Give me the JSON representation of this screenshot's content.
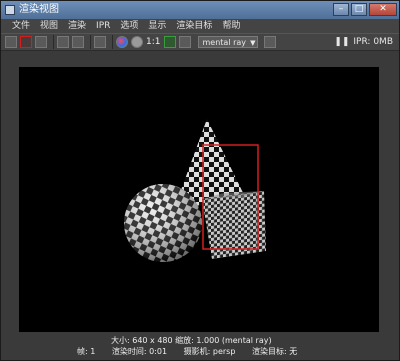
{
  "window": {
    "title": "渲染视图",
    "controls": {
      "minimize": "–",
      "maximize": "□",
      "close": "✕"
    }
  },
  "menubar": {
    "items": [
      {
        "label": "文件"
      },
      {
        "label": "视图"
      },
      {
        "label": "渲染"
      },
      {
        "label": "IPR"
      },
      {
        "label": "选项"
      },
      {
        "label": "显示"
      },
      {
        "label": "渲染目标"
      },
      {
        "label": "帮助"
      }
    ]
  },
  "toolbar": {
    "ratio_label": "1:1",
    "renderer": "mental ray",
    "ipr_label": "IPR: 0MB",
    "icons": [
      "redo-previous-render-icon",
      "render-region-icon",
      "snapshot-icon",
      "ipr-render-icon",
      "refresh-icon",
      "keep-image-icon",
      "rgb-channels-icon",
      "alpha-channel-icon",
      "real-size-icon",
      "display-color-icon"
    ]
  },
  "status": {
    "line1": "大小: 640 x 480  缩放: 1.000          (mental ray)",
    "frame": "帧: 1",
    "render_time": "渲染时间: 0:01",
    "camera": "摄影机: persp",
    "render_target": "渲染目标: 无"
  },
  "colors": {
    "window_bg": "#3a3a3a",
    "viewport_bg": "#000000",
    "selection": "#d21e1e"
  }
}
